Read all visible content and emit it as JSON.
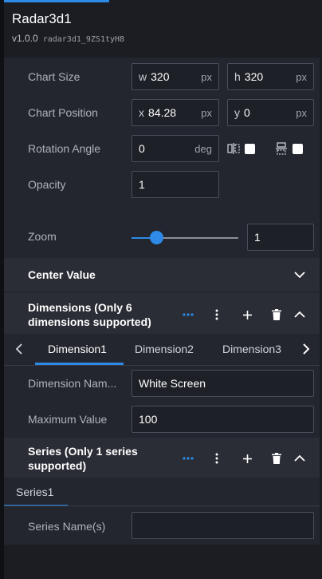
{
  "header": {
    "title": "Radar3d1",
    "version": "v1.0.0",
    "component_id": "radar3d1_9ZS1tyH8"
  },
  "chart_size": {
    "label": "Chart Size",
    "width_prefix": "w",
    "width_value": "320",
    "width_unit": "px",
    "height_prefix": "h",
    "height_value": "320",
    "height_unit": "px"
  },
  "chart_position": {
    "label": "Chart Position",
    "x_prefix": "x",
    "x_value": "84.28",
    "x_unit": "px",
    "y_prefix": "y",
    "y_value": "0",
    "y_unit": "px"
  },
  "rotation": {
    "label": "Rotation Angle",
    "value": "0",
    "unit": "deg",
    "flip_horizontal_checked": false,
    "flip_vertical_checked": false
  },
  "opacity": {
    "label": "Opacity",
    "value": "1"
  },
  "zoom": {
    "label": "Zoom",
    "value": "1",
    "level": 0.2
  },
  "center_value": {
    "title": "Center Value"
  },
  "dimensions": {
    "title_line1": "Dimensions (Only 6",
    "title_line2": "dimensions supported)",
    "tabs": [
      "Dimension1",
      "Dimension2",
      "Dimension3"
    ],
    "active_tab": "Dimension1",
    "name_label": "Dimension Nam...",
    "name_value": "White Screen",
    "max_label": "Maximum Value",
    "max_value": "100"
  },
  "series": {
    "title_line1": "Series (Only 1 series",
    "title_line2": "supported)",
    "tab": "Series1",
    "names_label": "Series Name(s)",
    "names_value": ""
  },
  "icons": {
    "more_dots": "ellipsis-icon",
    "more_vertical": "vertical-dots-icon",
    "add": "plus-icon",
    "delete": "trash-icon",
    "collapse": "chevron-up-icon",
    "expand": "chevron-down-icon"
  },
  "colors": {
    "accent": "#2e8ae6",
    "panel": "#23262e",
    "background": "#1b1d23"
  }
}
